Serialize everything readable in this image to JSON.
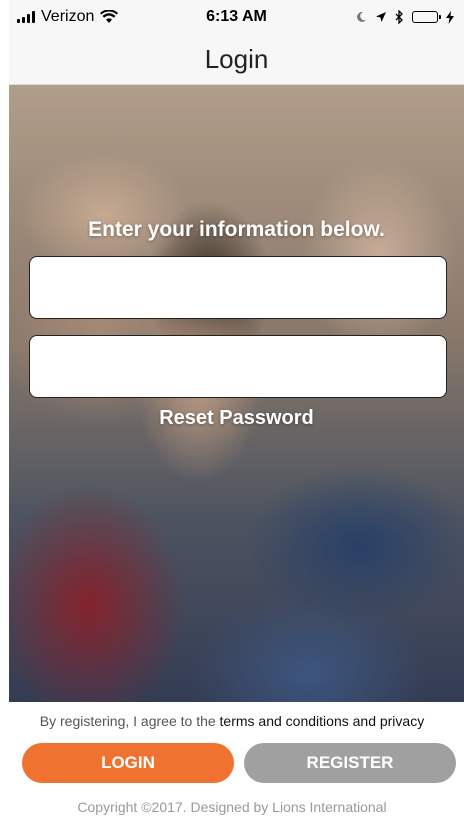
{
  "status_bar": {
    "carrier": "Verizon",
    "time": "6:13 AM",
    "battery_color": "#4cd964",
    "icons": [
      "signal-bars-icon",
      "wifi-icon",
      "moon-icon",
      "location-arrow-icon",
      "bluetooth-icon",
      "battery-icon",
      "charging-bolt-icon"
    ]
  },
  "nav": {
    "title": "Login"
  },
  "hero": {
    "heading": "Enter your information below.",
    "reset_password": "Reset Password"
  },
  "form": {
    "username_value": "",
    "password_value": ""
  },
  "footer": {
    "terms_prefix": "By registering, I agree to the ",
    "terms_link": "terms and conditions and privacy",
    "login_label": "LOGIN",
    "register_label": "REGISTER",
    "copyright": "Copyright ©2017. Designed by Lions International"
  },
  "colors": {
    "login_button": "#f07230",
    "register_button": "#a0a0a0"
  }
}
